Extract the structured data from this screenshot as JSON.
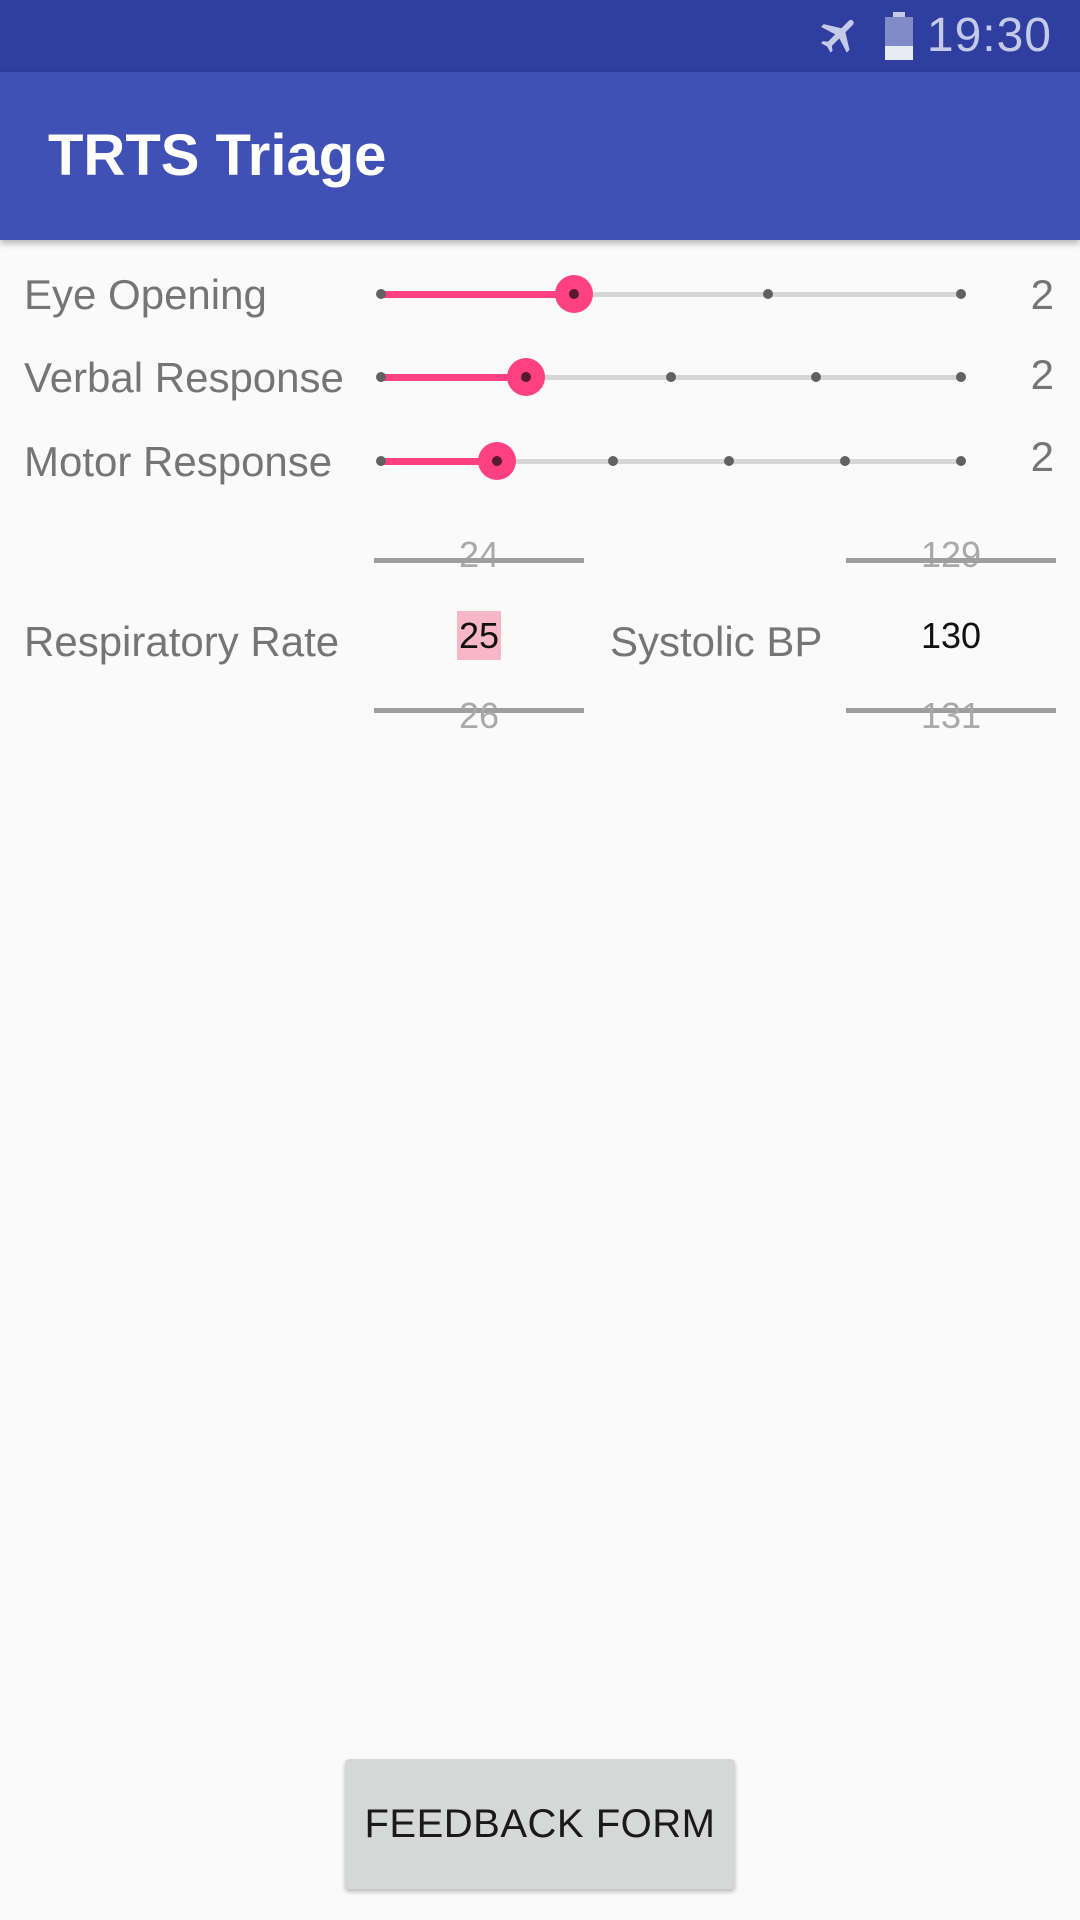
{
  "status_bar": {
    "time": "19:30",
    "icons": [
      "airplane-icon",
      "battery-icon"
    ],
    "color": "#2f3e9f"
  },
  "app_bar": {
    "title": "TRTS Triage",
    "color": "#3f51b5"
  },
  "accent_color": "#ff4081",
  "sliders": [
    {
      "label": "Eye Opening",
      "value": "2",
      "steps": 4,
      "position": 1
    },
    {
      "label": "Verbal Response",
      "value": "2",
      "steps": 5,
      "position": 1
    },
    {
      "label": "Motor Response",
      "value": "2",
      "steps": 6,
      "position": 1
    }
  ],
  "respiratory": {
    "label": "Respiratory Rate",
    "prev": "24",
    "current": "25",
    "next": "26"
  },
  "systolic": {
    "label": "Systolic BP",
    "prev": "129",
    "current": "130",
    "next": "131"
  },
  "feedback_button": {
    "label": "FEEDBACK FORM"
  }
}
